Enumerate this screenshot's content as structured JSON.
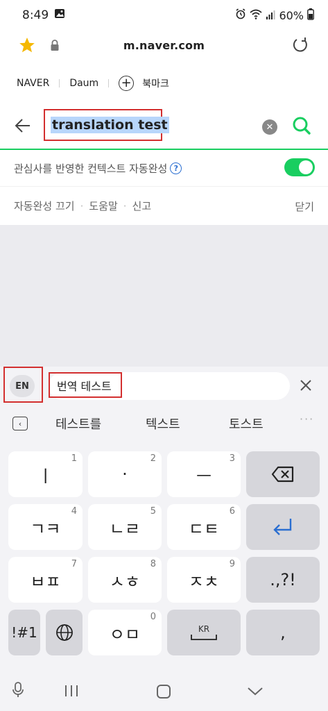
{
  "status_bar": {
    "time": "8:49",
    "battery": "60%"
  },
  "url_bar": {
    "url": "m.naver.com"
  },
  "bookmarks": {
    "items": [
      "NAVER",
      "Daum"
    ],
    "bookmark_label": "북마크"
  },
  "search": {
    "query": "translation test"
  },
  "autocomplete": {
    "context_label": "관심사를 반영한 컨텍스트 자동완성",
    "help_glyph": "?",
    "toggle_on": true,
    "links": [
      "자동완성 끄기",
      "도움말",
      "신고"
    ],
    "close_label": "닫기"
  },
  "translate_bar": {
    "language": "EN",
    "text": "번역 테스트"
  },
  "suggestions": [
    "테스트를",
    "텍스트",
    "토스트"
  ],
  "keyboard": {
    "rows": [
      [
        {
          "label": "ㅣ",
          "num": "1"
        },
        {
          "label": "·",
          "num": "2"
        },
        {
          "label": "ㅡ",
          "num": "3"
        }
      ],
      [
        {
          "label": "ㄱㅋ",
          "num": "4"
        },
        {
          "label": "ㄴㄹ",
          "num": "5"
        },
        {
          "label": "ㄷㅌ",
          "num": "6"
        }
      ],
      [
        {
          "label": "ㅂㅍ",
          "num": "7"
        },
        {
          "label": "ㅅㅎ",
          "num": "8"
        },
        {
          "label": "ㅈㅊ",
          "num": "9"
        }
      ],
      [
        {
          "label": "ㅇㅁ",
          "num": "0"
        }
      ]
    ],
    "punct_label": ".,?!",
    "symbols_label": "!#1",
    "space_label": "KR",
    "comma_label": ","
  },
  "colors": {
    "accent_green": "#19ce60",
    "highlight_red": "#d32f2f",
    "selection_blue": "#b8d6fb"
  }
}
